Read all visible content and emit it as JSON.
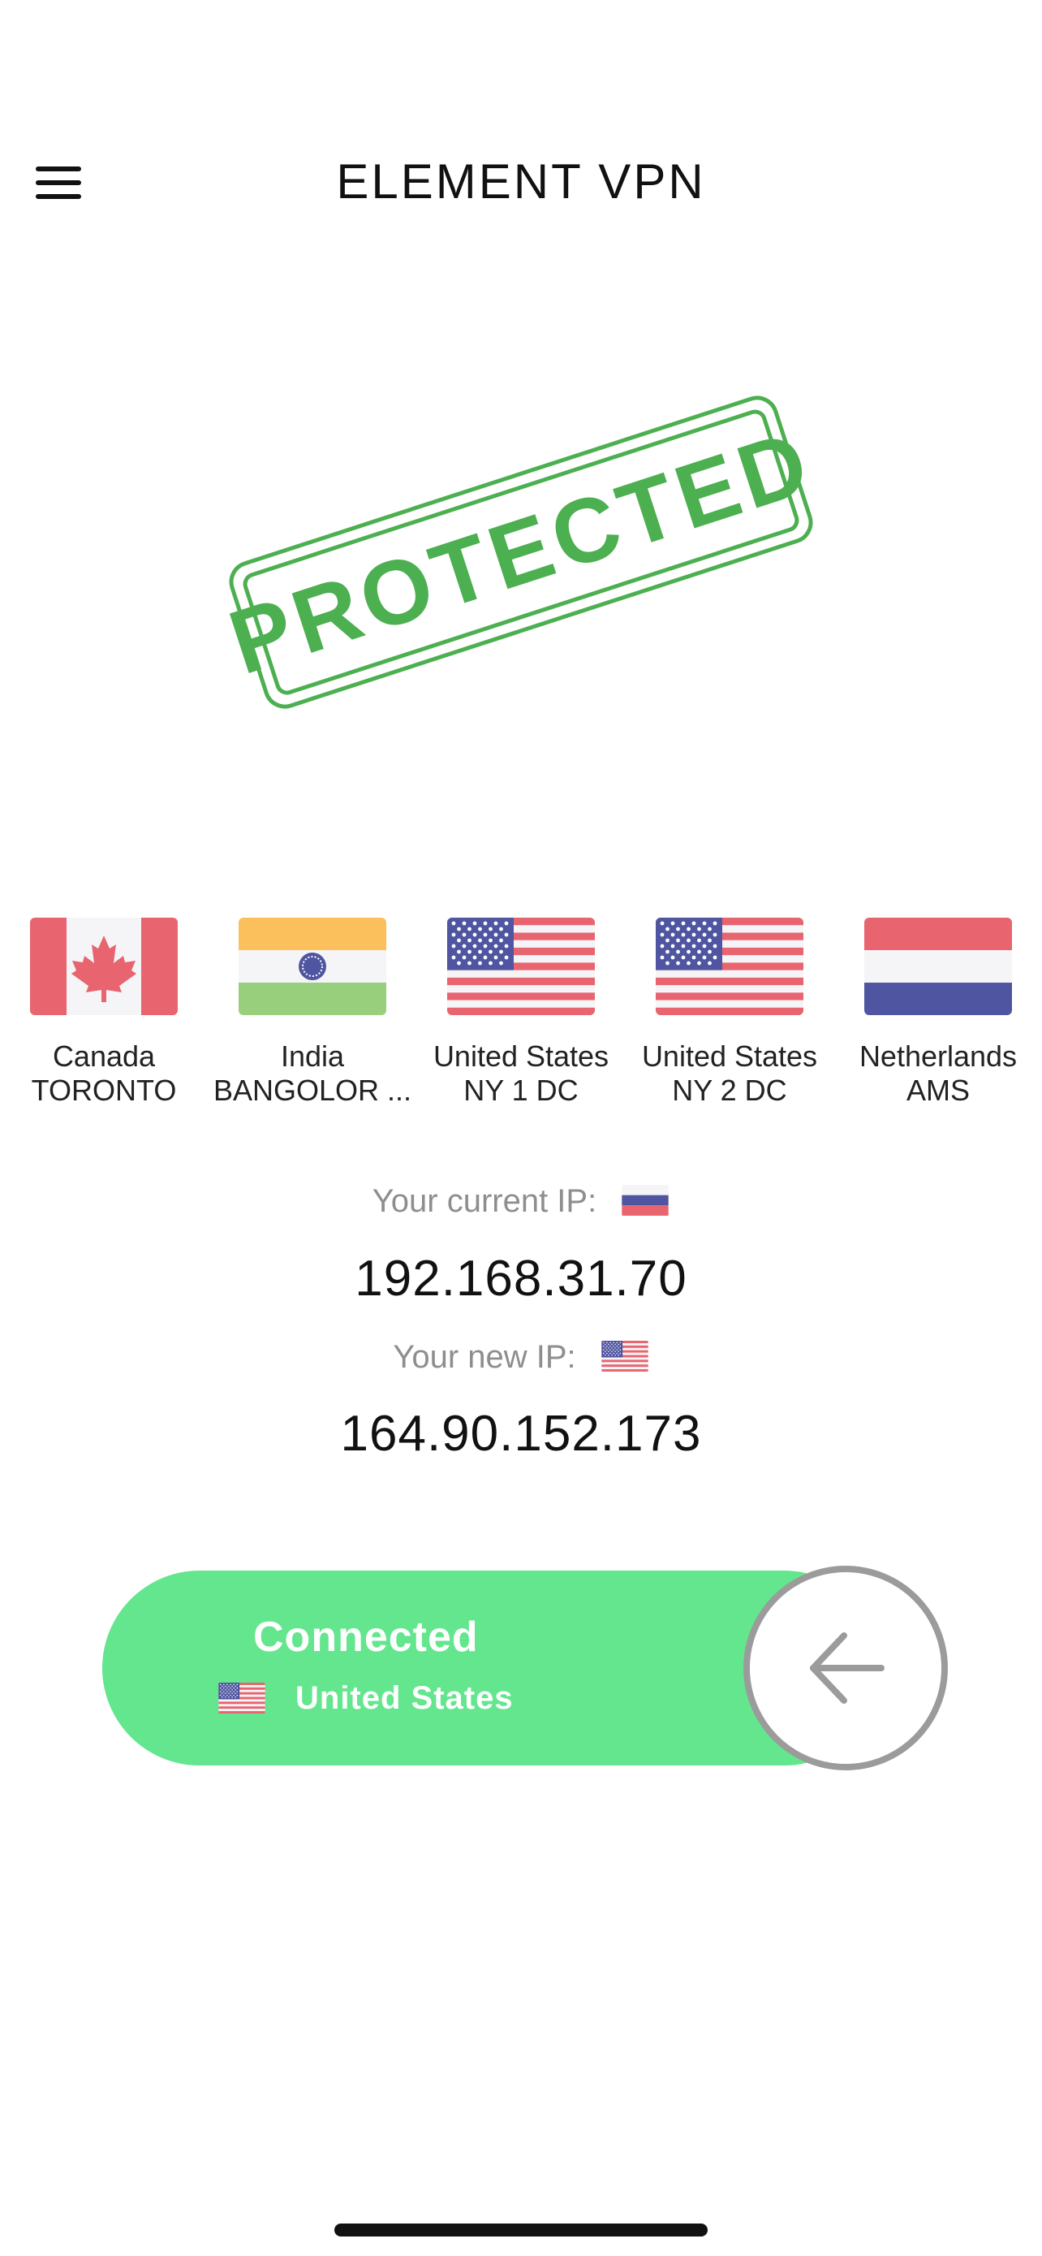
{
  "header": {
    "title": "ELEMENT VPN",
    "menu_icon": "hamburger-menu-icon"
  },
  "stamp": {
    "text": "PROTECTED",
    "color": "#4caf50"
  },
  "servers": [
    {
      "country": "Canada",
      "city": "TORONTO",
      "flag": "canada-flag-icon"
    },
    {
      "country": "India",
      "city": "BANGOLOR ...",
      "flag": "india-flag-icon"
    },
    {
      "country": "United States",
      "city": "NY 1 DC",
      "flag": "usa-flag-icon"
    },
    {
      "country": "United States",
      "city": "NY 2 DC",
      "flag": "usa-flag-icon"
    },
    {
      "country": "Netherlands",
      "city": "AMS",
      "flag": "netherlands-flag-icon"
    }
  ],
  "ip": {
    "current_label": "Your current IP:",
    "current_value": "192.168.31.70",
    "current_flag": "russia-flag-icon",
    "new_label": "Your new IP:",
    "new_value": "164.90.152.173",
    "new_flag": "usa-flag-icon"
  },
  "connection": {
    "status": "Connected",
    "country": "United States",
    "flag": "usa-flag-icon",
    "slider_color": "#63e68d",
    "knob_icon": "arrow-left-icon"
  }
}
